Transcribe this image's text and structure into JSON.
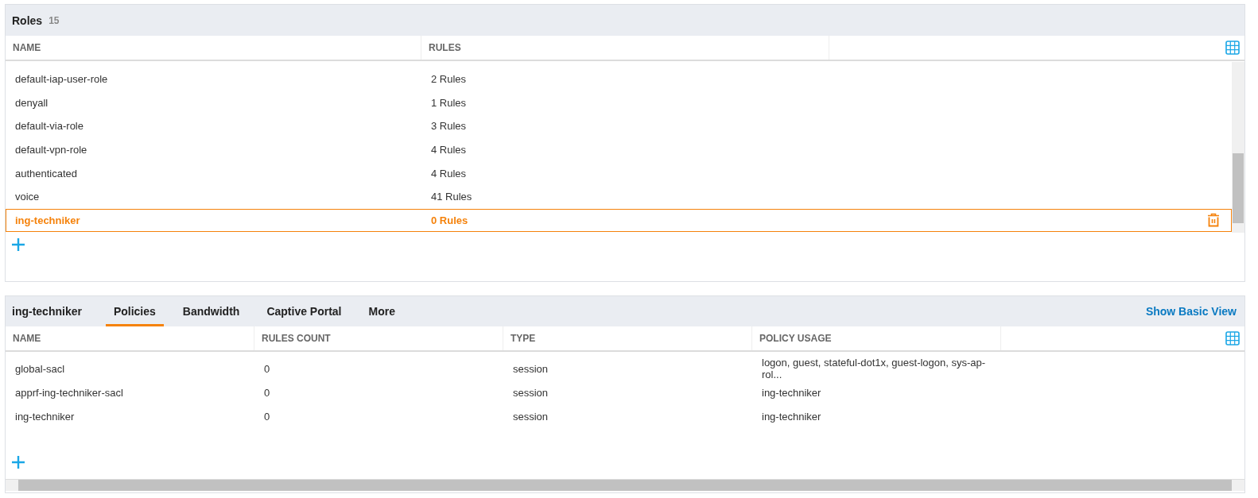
{
  "roles_panel": {
    "title": "Roles",
    "count": "15",
    "table": {
      "columns": [
        "NAME",
        "RULES"
      ],
      "rows": [
        {
          "name": "default-iap-user-role",
          "rules": "2 Rules",
          "selected": false
        },
        {
          "name": "denyall",
          "rules": "1 Rules",
          "selected": false
        },
        {
          "name": "default-via-role",
          "rules": "3 Rules",
          "selected": false
        },
        {
          "name": "default-vpn-role",
          "rules": "4 Rules",
          "selected": false
        },
        {
          "name": "authenticated",
          "rules": "4 Rules",
          "selected": false
        },
        {
          "name": "voice",
          "rules": "41 Rules",
          "selected": false
        },
        {
          "name": "ing-techniker",
          "rules": "0 Rules",
          "selected": true
        }
      ]
    }
  },
  "detail_panel": {
    "title": "ing-techniker",
    "tabs": [
      {
        "label": "Policies",
        "selected": true
      },
      {
        "label": "Bandwidth",
        "selected": false
      },
      {
        "label": "Captive Portal",
        "selected": false
      },
      {
        "label": "More",
        "selected": false
      }
    ],
    "link": "Show Basic View",
    "table": {
      "columns": [
        "NAME",
        "RULES COUNT",
        "TYPE",
        "POLICY USAGE"
      ],
      "rows": [
        [
          "global-sacl",
          "0",
          "session",
          "logon, guest, stateful-dot1x, guest-logon, sys-ap-rol..."
        ],
        [
          "apprf-ing-techniker-sacl",
          "0",
          "session",
          "ing-techniker"
        ],
        [
          "ing-techniker",
          "0",
          "session",
          "ing-techniker"
        ]
      ]
    }
  }
}
